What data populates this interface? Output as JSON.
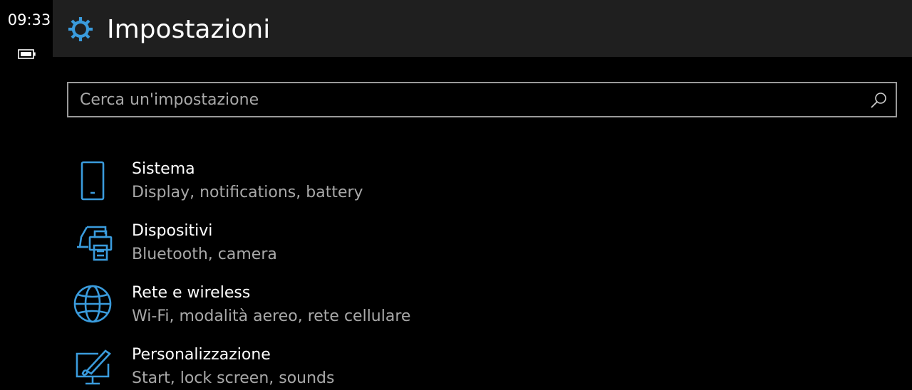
{
  "status": {
    "time": "09:33",
    "battery_icon": "battery-icon"
  },
  "header": {
    "icon": "gear-icon",
    "title": "Impostazioni"
  },
  "search": {
    "placeholder": "Cerca un'impostazione",
    "value": "",
    "icon": "search-icon"
  },
  "colors": {
    "accent": "#3a9bdc",
    "header_bg": "#1f1f1f",
    "background": "#000000",
    "text_primary": "#ffffff",
    "text_secondary": "#a8a8a8",
    "search_border": "#9a9a9a"
  },
  "items": [
    {
      "title": "Sistema",
      "subtitle": "Display, notifications, battery",
      "icon": "phone-icon"
    },
    {
      "title": "Dispositivi",
      "subtitle": "Bluetooth, camera",
      "icon": "devices-icon"
    },
    {
      "title": "Rete e wireless",
      "subtitle": "Wi-Fi, modalità aereo, rete cellulare",
      "icon": "globe-icon"
    },
    {
      "title": "Personalizzazione",
      "subtitle": "Start, lock screen, sounds",
      "icon": "personalization-icon"
    }
  ]
}
